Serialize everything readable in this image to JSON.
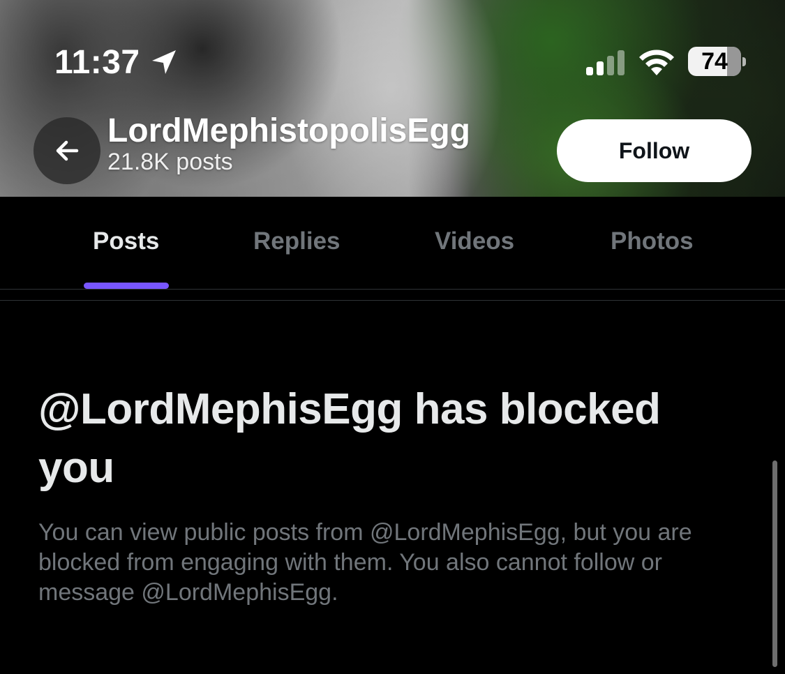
{
  "status_bar": {
    "time": "11:37",
    "battery": "74",
    "battery_level": 0.74,
    "location_icon": "location-arrow-icon",
    "signal_icon": "cellular-signal-icon",
    "wifi_icon": "wifi-icon"
  },
  "header": {
    "back_icon": "arrow-left-icon",
    "display_name": "LordMephistopolisEgg",
    "post_count": "21.8K posts",
    "follow_label": "Follow"
  },
  "tabs": [
    {
      "label": "Posts",
      "active": true
    },
    {
      "label": "Replies",
      "active": false
    },
    {
      "label": "Videos",
      "active": false
    },
    {
      "label": "Photos",
      "active": false
    }
  ],
  "blocked": {
    "title": "@LordMephisEgg has blocked you",
    "description": "You can view public posts from @LordMephisEgg, but you are blocked from engaging with them. You also cannot follow or message @LordMephisEgg."
  },
  "colors": {
    "background": "#000000",
    "accent": "#7856ff",
    "text_primary": "#e7e9ea",
    "text_secondary": "#71767b",
    "divider": "#2f3336"
  }
}
